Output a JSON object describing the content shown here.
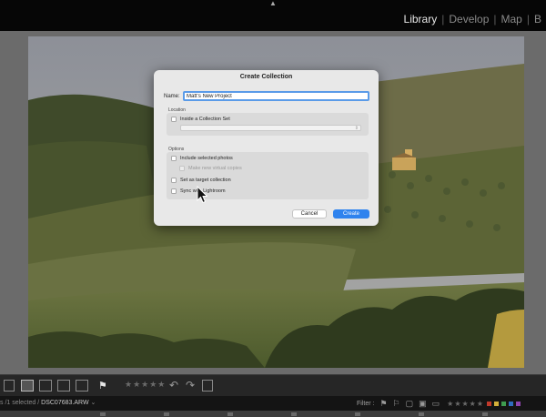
{
  "header": {
    "collapse_arrow": "▲",
    "modules": [
      {
        "label": "Library",
        "active": true
      },
      {
        "label": "Develop",
        "active": false
      },
      {
        "label": "Map",
        "active": false
      },
      {
        "label": "B",
        "active": false
      }
    ],
    "separator": "|"
  },
  "photo": {
    "subject": "tuscan-hillside-landscape"
  },
  "dialog": {
    "title": "Create Collection",
    "name_label": "Name:",
    "name_value": "Matt's New Project",
    "location_label": "Location",
    "inside_collection_set": "Inside a Collection Set",
    "collection_set_value": "",
    "options_label": "Options",
    "include_selected": "Include selected photos",
    "make_virtual_copies": "Make new virtual copies",
    "set_as_target": "Set as target collection",
    "sync_with_lightroom": "Sync with Lightroom",
    "cancel_label": "Cancel",
    "create_label": "Create",
    "accent_color": "#2f83ee"
  },
  "toolbar": {
    "flag_symbol": "⚑",
    "stars": "★★★★★",
    "rotate_left": "↶",
    "rotate_right": "↷"
  },
  "filmstrip": {
    "selection_info": "s /1 selected /",
    "filename": "DSC07683.ARW",
    "dropdown": "⌄",
    "filter_label": "Filter :",
    "stars": "★★★★★",
    "label_colors": [
      "#c0392b",
      "#d4b03a",
      "#3e9b4f",
      "#2f6dc0",
      "#8e44ad"
    ]
  }
}
